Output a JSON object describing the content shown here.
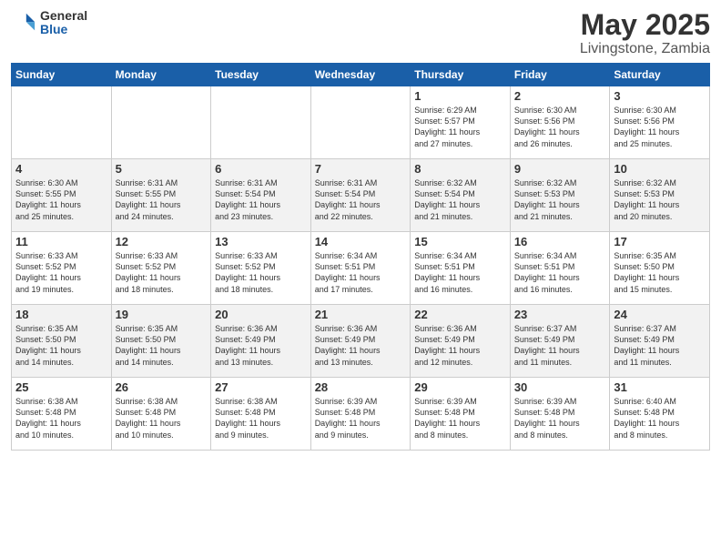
{
  "header": {
    "logo_general": "General",
    "logo_blue": "Blue",
    "month": "May 2025",
    "location": "Livingstone, Zambia"
  },
  "columns": [
    "Sunday",
    "Monday",
    "Tuesday",
    "Wednesday",
    "Thursday",
    "Friday",
    "Saturday"
  ],
  "weeks": [
    [
      {
        "day": "",
        "info": ""
      },
      {
        "day": "",
        "info": ""
      },
      {
        "day": "",
        "info": ""
      },
      {
        "day": "",
        "info": ""
      },
      {
        "day": "1",
        "info": "Sunrise: 6:29 AM\nSunset: 5:57 PM\nDaylight: 11 hours\nand 27 minutes."
      },
      {
        "day": "2",
        "info": "Sunrise: 6:30 AM\nSunset: 5:56 PM\nDaylight: 11 hours\nand 26 minutes."
      },
      {
        "day": "3",
        "info": "Sunrise: 6:30 AM\nSunset: 5:56 PM\nDaylight: 11 hours\nand 25 minutes."
      }
    ],
    [
      {
        "day": "4",
        "info": "Sunrise: 6:30 AM\nSunset: 5:55 PM\nDaylight: 11 hours\nand 25 minutes."
      },
      {
        "day": "5",
        "info": "Sunrise: 6:31 AM\nSunset: 5:55 PM\nDaylight: 11 hours\nand 24 minutes."
      },
      {
        "day": "6",
        "info": "Sunrise: 6:31 AM\nSunset: 5:54 PM\nDaylight: 11 hours\nand 23 minutes."
      },
      {
        "day": "7",
        "info": "Sunrise: 6:31 AM\nSunset: 5:54 PM\nDaylight: 11 hours\nand 22 minutes."
      },
      {
        "day": "8",
        "info": "Sunrise: 6:32 AM\nSunset: 5:54 PM\nDaylight: 11 hours\nand 21 minutes."
      },
      {
        "day": "9",
        "info": "Sunrise: 6:32 AM\nSunset: 5:53 PM\nDaylight: 11 hours\nand 21 minutes."
      },
      {
        "day": "10",
        "info": "Sunrise: 6:32 AM\nSunset: 5:53 PM\nDaylight: 11 hours\nand 20 minutes."
      }
    ],
    [
      {
        "day": "11",
        "info": "Sunrise: 6:33 AM\nSunset: 5:52 PM\nDaylight: 11 hours\nand 19 minutes."
      },
      {
        "day": "12",
        "info": "Sunrise: 6:33 AM\nSunset: 5:52 PM\nDaylight: 11 hours\nand 18 minutes."
      },
      {
        "day": "13",
        "info": "Sunrise: 6:33 AM\nSunset: 5:52 PM\nDaylight: 11 hours\nand 18 minutes."
      },
      {
        "day": "14",
        "info": "Sunrise: 6:34 AM\nSunset: 5:51 PM\nDaylight: 11 hours\nand 17 minutes."
      },
      {
        "day": "15",
        "info": "Sunrise: 6:34 AM\nSunset: 5:51 PM\nDaylight: 11 hours\nand 16 minutes."
      },
      {
        "day": "16",
        "info": "Sunrise: 6:34 AM\nSunset: 5:51 PM\nDaylight: 11 hours\nand 16 minutes."
      },
      {
        "day": "17",
        "info": "Sunrise: 6:35 AM\nSunset: 5:50 PM\nDaylight: 11 hours\nand 15 minutes."
      }
    ],
    [
      {
        "day": "18",
        "info": "Sunrise: 6:35 AM\nSunset: 5:50 PM\nDaylight: 11 hours\nand 14 minutes."
      },
      {
        "day": "19",
        "info": "Sunrise: 6:35 AM\nSunset: 5:50 PM\nDaylight: 11 hours\nand 14 minutes."
      },
      {
        "day": "20",
        "info": "Sunrise: 6:36 AM\nSunset: 5:49 PM\nDaylight: 11 hours\nand 13 minutes."
      },
      {
        "day": "21",
        "info": "Sunrise: 6:36 AM\nSunset: 5:49 PM\nDaylight: 11 hours\nand 13 minutes."
      },
      {
        "day": "22",
        "info": "Sunrise: 6:36 AM\nSunset: 5:49 PM\nDaylight: 11 hours\nand 12 minutes."
      },
      {
        "day": "23",
        "info": "Sunrise: 6:37 AM\nSunset: 5:49 PM\nDaylight: 11 hours\nand 11 minutes."
      },
      {
        "day": "24",
        "info": "Sunrise: 6:37 AM\nSunset: 5:49 PM\nDaylight: 11 hours\nand 11 minutes."
      }
    ],
    [
      {
        "day": "25",
        "info": "Sunrise: 6:38 AM\nSunset: 5:48 PM\nDaylight: 11 hours\nand 10 minutes."
      },
      {
        "day": "26",
        "info": "Sunrise: 6:38 AM\nSunset: 5:48 PM\nDaylight: 11 hours\nand 10 minutes."
      },
      {
        "day": "27",
        "info": "Sunrise: 6:38 AM\nSunset: 5:48 PM\nDaylight: 11 hours\nand 9 minutes."
      },
      {
        "day": "28",
        "info": "Sunrise: 6:39 AM\nSunset: 5:48 PM\nDaylight: 11 hours\nand 9 minutes."
      },
      {
        "day": "29",
        "info": "Sunrise: 6:39 AM\nSunset: 5:48 PM\nDaylight: 11 hours\nand 8 minutes."
      },
      {
        "day": "30",
        "info": "Sunrise: 6:39 AM\nSunset: 5:48 PM\nDaylight: 11 hours\nand 8 minutes."
      },
      {
        "day": "31",
        "info": "Sunrise: 6:40 AM\nSunset: 5:48 PM\nDaylight: 11 hours\nand 8 minutes."
      }
    ]
  ]
}
